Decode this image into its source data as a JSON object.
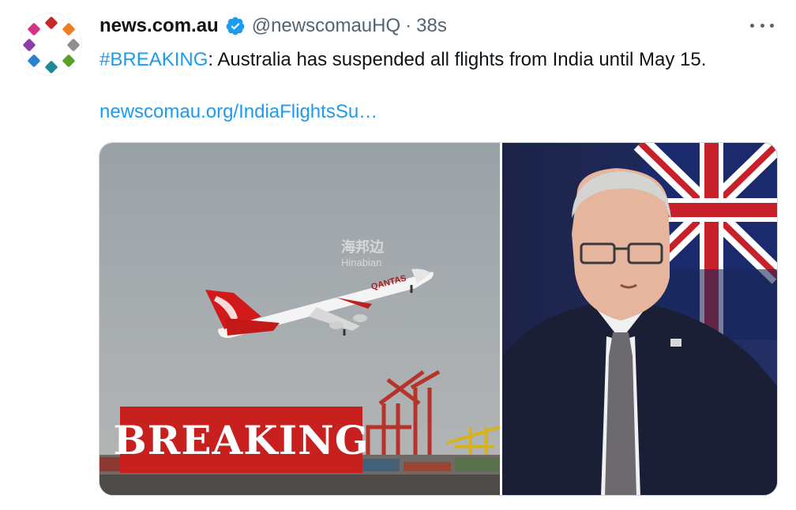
{
  "tweet": {
    "display_name": "news.com.au",
    "handle": "@newscomauHQ",
    "separator": "·",
    "timestamp": "38s",
    "hashtag": "#BREAKING",
    "body": ": Australia has suspended all flights from India until May 15.",
    "link": "newscomau.org/IndiaFlightsSu…"
  },
  "media": {
    "banner_text": "BREAKING",
    "watermark_cn": "海邦边",
    "watermark_en": "Hinabian",
    "airline_text": "QANTAS"
  },
  "colors": {
    "link": "#1d9bf0",
    "verified": "#1d9bf0",
    "banner": "#c8201e",
    "secondary_text": "#536471"
  },
  "icons": {
    "avatar": "news-logo-dots",
    "verified": "verified-badge-icon",
    "more": "more-options-icon"
  }
}
